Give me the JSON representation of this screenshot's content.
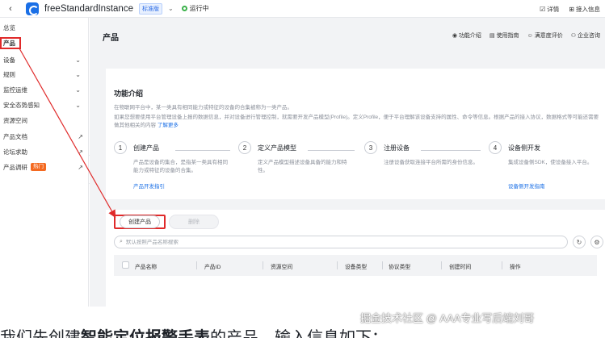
{
  "topbar": {
    "back_icon": "chevron-left-icon",
    "instance_name": "freeStandardInstance",
    "edition_badge": "标准版",
    "status": "运行中",
    "status_color": "#3bb14a",
    "right_links": [
      "详情",
      "接入信息"
    ],
    "right_icons": [
      "detail-icon",
      "access-info-icon"
    ]
  },
  "sidebar": {
    "items": [
      {
        "label": "总览",
        "kind": "plain"
      },
      {
        "label": "产品",
        "kind": "active"
      },
      {
        "label": "设备",
        "kind": "expand"
      },
      {
        "label": "规则",
        "kind": "expand"
      },
      {
        "label": "监控运维",
        "kind": "expand"
      },
      {
        "label": "安全态势感知",
        "kind": "expand"
      },
      {
        "label": "资源空间",
        "kind": "plain"
      },
      {
        "label": "产品文档",
        "kind": "external"
      },
      {
        "label": "论坛求助",
        "kind": "external"
      },
      {
        "label": "产品调研",
        "kind": "external",
        "badge": "热门"
      }
    ],
    "badge_color": "#f46a21"
  },
  "main": {
    "page_title": "产品",
    "head_links": [
      "功能介绍",
      "使用指南",
      "满意度评价",
      "企业咨询"
    ],
    "intro": {
      "title": "功能介绍",
      "line1": "在物联网平台中，某一类具有相同能力或特征的设备的合集被称为一类产品。",
      "line2": "如果您想要使用平台管理设备上报的数据信息，并对设备进行管理控制，就需要开发产品模型(Profile)。定义Profile，便于平台理解该设备支持的属性、命令等信息。根据产品的接入协议，数据格式等可能还需要做其他相关的内容",
      "line2_link": "了解更多",
      "steps": [
        {
          "num": "1",
          "title": "创建产品",
          "desc": "产品是设备的集合，是指某一类具有相同能力或特征的设备的合集。",
          "link": "产品开发指引"
        },
        {
          "num": "2",
          "title": "定义产品模型",
          "desc": "定义产品模型描述设备具备的能力和特性。",
          "link": ""
        },
        {
          "num": "3",
          "title": "注册设备",
          "desc": "注册设备获取连接平台所需的身份信息。",
          "link": ""
        },
        {
          "num": "4",
          "title": "设备侧开发",
          "desc": "集成设备侧SDK，使设备接入平台。",
          "link": "设备侧开发指南"
        }
      ]
    },
    "list": {
      "create_label": "创建产品",
      "delete_label": "删除",
      "search_placeholder": "默认按照产品名称搜索",
      "columns": [
        "产品名称",
        "产品ID",
        "资源空间",
        "设备类型",
        "协议类型",
        "创建时间",
        "操作"
      ]
    }
  },
  "annotation_color": "#e02a2a",
  "bottom": {
    "text_pre": "我们先创建",
    "text_bold": "智能定位报警手表",
    "text_post": "的产品，输入信息如下：",
    "watermark": "掘金技术社区 @ AAA专业写后端刘哥"
  }
}
